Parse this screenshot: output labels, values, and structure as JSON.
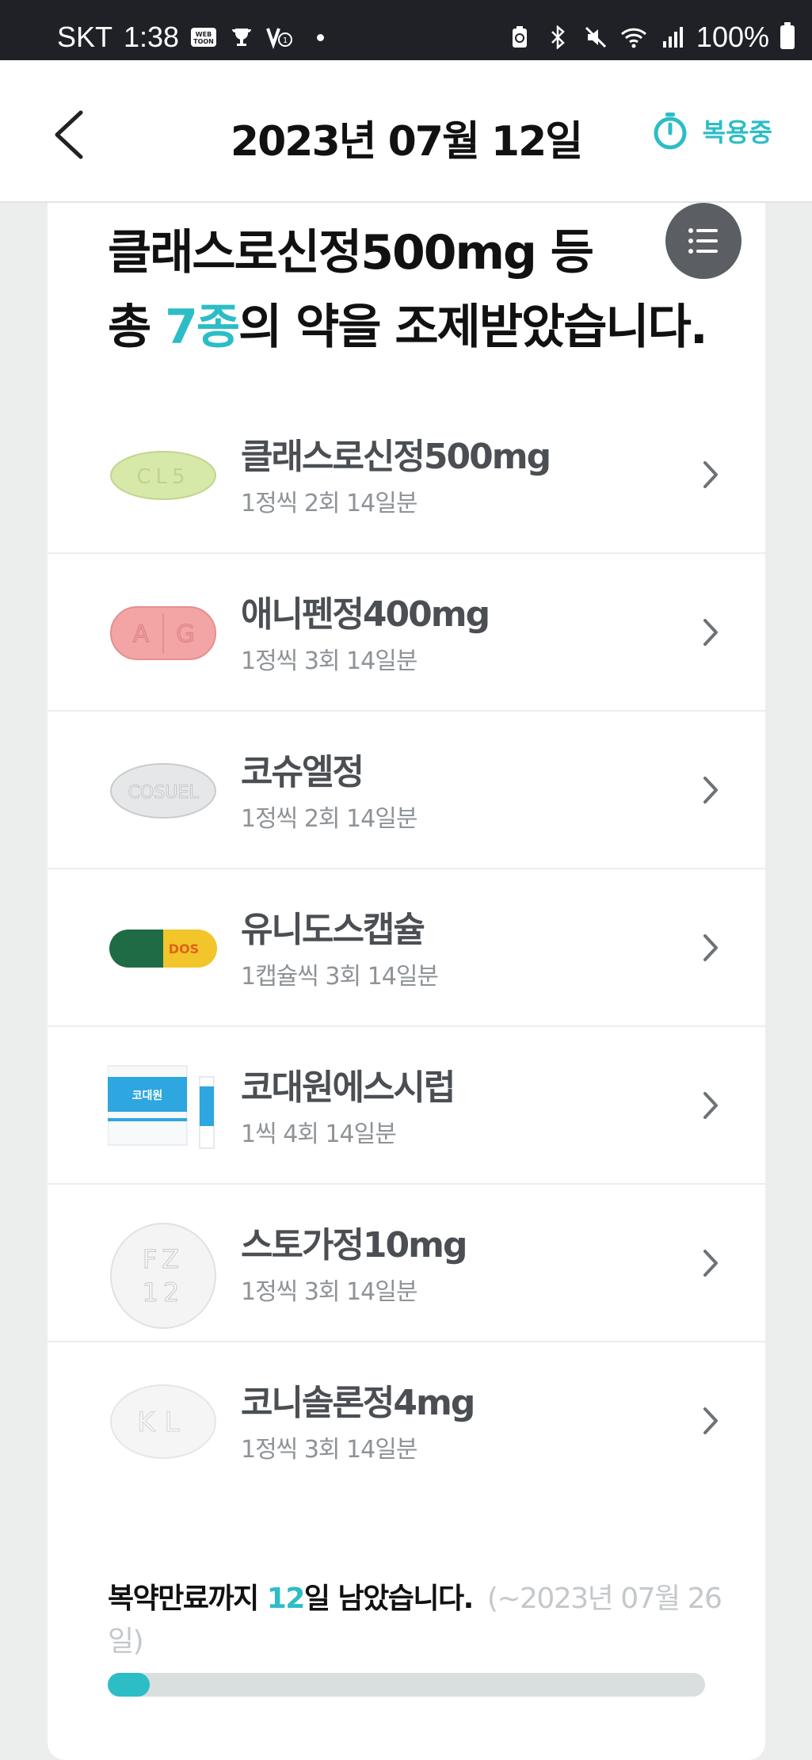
{
  "status_bar": {
    "carrier": "SKT",
    "time": "1:38",
    "battery": "100%",
    "left_icons": [
      "webtoon-icon",
      "trophy-icon",
      "league-icon"
    ],
    "right_icons": [
      "battery-saver-icon",
      "bluetooth-icon",
      "mute-icon",
      "wifi-icon",
      "signal-icon"
    ]
  },
  "header": {
    "title": "2023년 07월 12일",
    "status_label": "복용중",
    "accent_color": "#2cbdc6"
  },
  "summary": {
    "line1": "클래스로신정500mg 등",
    "line2_prefix": "총 ",
    "count": "7종",
    "line2_suffix": "의 약을 조제받았습니다."
  },
  "medicines": [
    {
      "name": "클래스로신정500mg",
      "dosage": "1정씩 2회 14일분",
      "imprint": "CL5",
      "icon": "pill-oval-green-icon"
    },
    {
      "name": "애니펜정400mg",
      "dosage": "1정씩 3회 14일분",
      "imprint": "A|G",
      "icon": "pill-oval-pink-icon"
    },
    {
      "name": "코슈엘정",
      "dosage": "1정씩 2회 14일분",
      "imprint": "COSUEL",
      "icon": "pill-oval-white-icon"
    },
    {
      "name": "유니도스캡슐",
      "dosage": "1캡슐씩 3회 14일분",
      "imprint": "DOS",
      "icon": "capsule-green-yellow-icon"
    },
    {
      "name": "코대원에스시럽",
      "dosage": "1씩 4회 14일분",
      "imprint": "코대원",
      "icon": "syrup-box-icon"
    },
    {
      "name": "스토가정10mg",
      "dosage": "1정씩 3회 14일분",
      "imprint": "FZ 12",
      "icon": "pill-round-white-icon"
    },
    {
      "name": "코니솔론정4mg",
      "dosage": "1정씩 3회 14일분",
      "imprint": "KL",
      "icon": "pill-round-white-icon"
    }
  ],
  "footer": {
    "remain_prefix": "복약만료까지 ",
    "remain_days": "12",
    "remain_suffix": "일 남았습니다.",
    "until": "(~2023년 07월 26일)",
    "progress": 0.07
  }
}
